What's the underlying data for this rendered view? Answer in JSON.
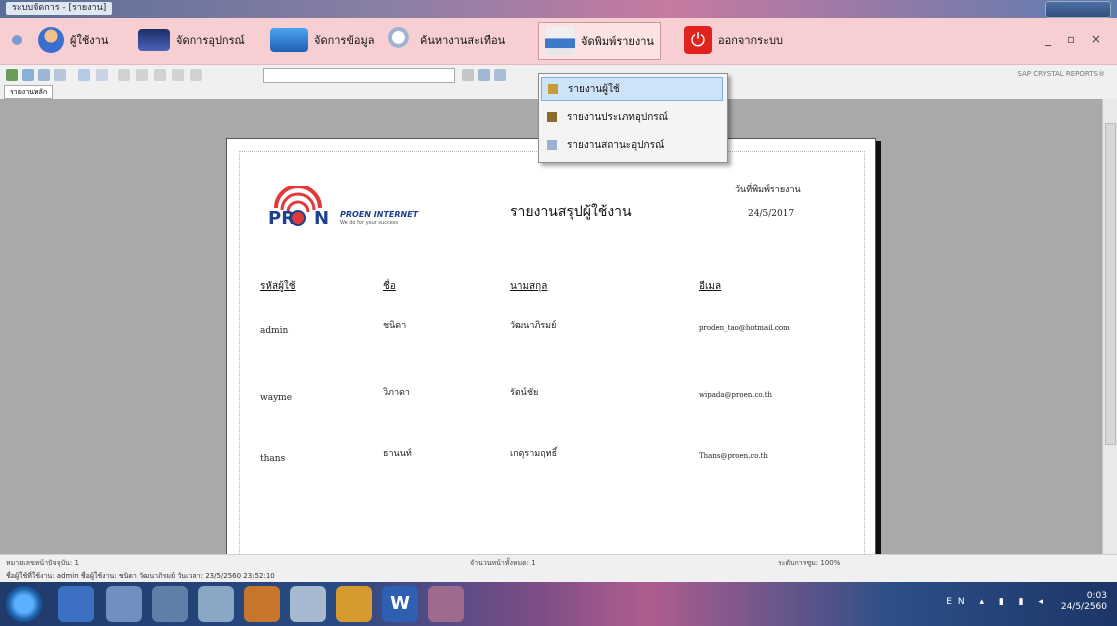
{
  "window": {
    "title": "ระบบจัดการ - [รายงาน]"
  },
  "toolbar": {
    "items": [
      {
        "label": "ผู้ใช้งาน",
        "icon": "user-icon"
      },
      {
        "label": "จัดการอุปกรณ์",
        "icon": "monitor-icon"
      },
      {
        "label": "จัดการข้อมูล",
        "icon": "folder-icon"
      },
      {
        "label": "ค้นหางานสะเทือน",
        "icon": "search-icon"
      },
      {
        "label": "จัดพิมพ์รายงาน",
        "icon": "printer-icon"
      },
      {
        "label": "ออกจากระบบ",
        "icon": "power-icon"
      }
    ],
    "window_controls": "_ ▫ ×"
  },
  "viewer": {
    "brand": "SAP CRYSTAL REPORTS®",
    "tab": "รายงานหลัก",
    "status_left": "หมายเลขหน้าปัจจุบัน: 1",
    "status_mid": "จำนวนหน้าทั้งหมด: 1",
    "status_right": "ระดับการซูม: 100%"
  },
  "dropdown": {
    "items": [
      {
        "label": "รายงานผู้ใช้",
        "icon": "report-user-icon"
      },
      {
        "label": "รายงานประเภทอุปกรณ์",
        "icon": "report-type-icon"
      },
      {
        "label": "รายงานสถานะอุปกรณ์",
        "icon": "report-status-icon"
      }
    ]
  },
  "report": {
    "logo_letters": "PR",
    "logo_letters2": "N",
    "logo_brand": "PROEN INTERNET",
    "logo_tagline": "We do for your success",
    "title": "รายงานสรุปผู้ใช้งาน",
    "date_label": "วันที่พิมพ์รายงาน",
    "date_value": "24/5/2017",
    "columns": [
      "รหัสผู้ใช้",
      "ชื่อ",
      "นามสกุล",
      "อีเมล"
    ],
    "rows": [
      [
        "admin",
        "ชนิดา",
        "วัฒนาภิรมย์",
        "proden_tao@hotmail.com"
      ],
      [
        "wayme",
        "วิภาดา",
        "รัตน์ชัย",
        "wipada@proen.co.th"
      ],
      [
        "thans",
        "ธานนท์",
        "เกตุรามฤทธิ์",
        "Thans@proen.co.th"
      ]
    ]
  },
  "statusbar": {
    "text": "ชื่อผู้ใช้ที่ใช้งาน: admin ชื่อผู้ใช้งาน: ชนิดา วัฒนาภิรมย์ วันเวลา: 23/5/2560 23:52:10"
  },
  "taskbar": {
    "lang": "EN",
    "time": "0:03",
    "date": "24/5/2560"
  }
}
